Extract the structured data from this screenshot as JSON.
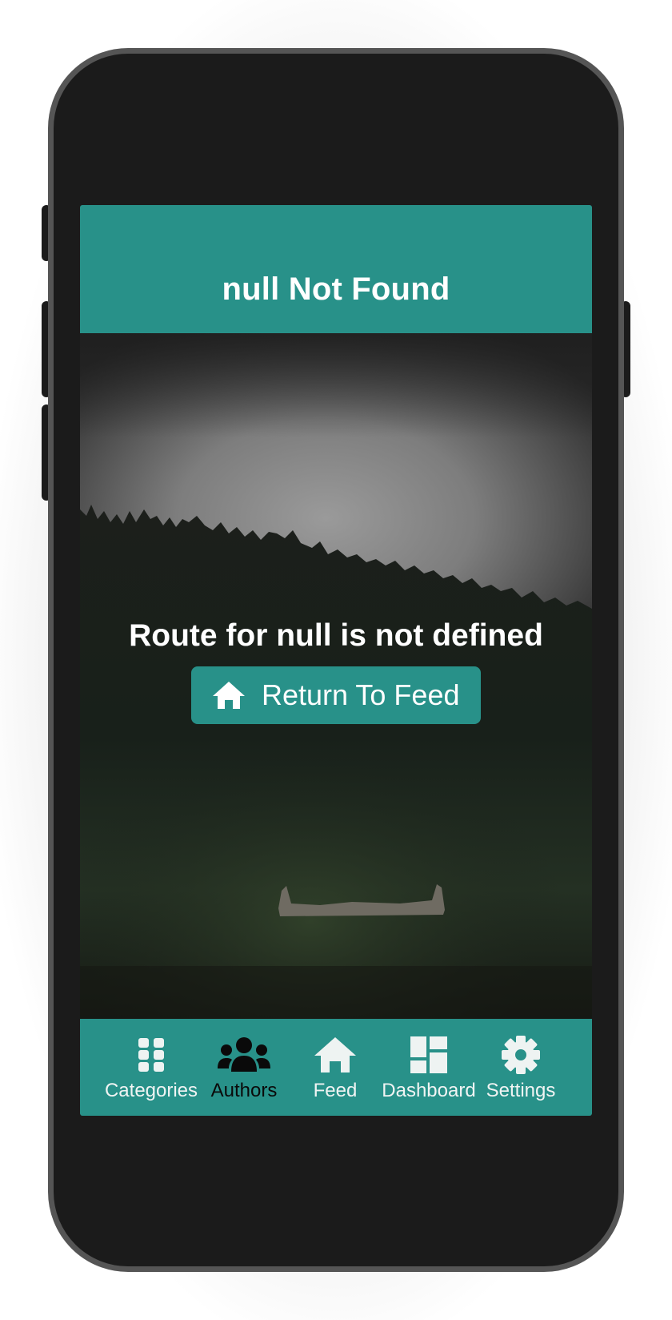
{
  "header": {
    "title": "null Not Found"
  },
  "main": {
    "message": "Route for null is not defined",
    "return_button": {
      "label": "Return To Feed",
      "icon": "home-icon"
    }
  },
  "bottom_nav": {
    "active": "Authors",
    "items": [
      {
        "label": "Categories",
        "icon": "grid-icon"
      },
      {
        "label": "Authors",
        "icon": "users-icon"
      },
      {
        "label": "Feed",
        "icon": "home-icon"
      },
      {
        "label": "Dashboard",
        "icon": "dashboard-icon"
      },
      {
        "label": "Settings",
        "icon": "gear-icon"
      }
    ]
  },
  "colors": {
    "accent": "#289189",
    "nav_icon": "#eef3f2",
    "active_nav": "#0a0a0a",
    "text_light": "#ffffff"
  }
}
